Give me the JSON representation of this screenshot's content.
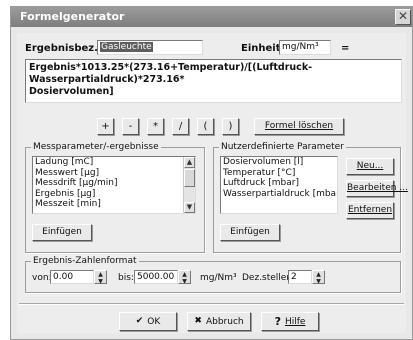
{
  "window": {
    "title": "Formelgenerator",
    "close_glyph": "✕"
  },
  "result": {
    "name_label": "Ergebnisbez.:",
    "name_value": "Gasleuchte",
    "unit_label": "Einheit:",
    "unit_value": "mg/Nm³",
    "equals": "="
  },
  "formula": {
    "line1": "Ergebnis*1013.25*(273.16+Temperatur)/[(Luftdruck-Wasserpartialdruck)*273.16*",
    "line2": "Dosiervolumen]"
  },
  "operators": [
    "+",
    "-",
    "*",
    "/",
    "(",
    ")"
  ],
  "clear_formula_label": "Formel löschen",
  "measure_group": {
    "legend": "Messparameter/-ergebnisse",
    "items": [
      "Ladung [mC]",
      "Messwert [µg]",
      "Messdrift [µg/min]",
      "Ergebnis [µg]",
      "Messzeit [min]"
    ],
    "insert_label": "Einfügen",
    "insert_accel": "i"
  },
  "user_group": {
    "legend": "Nutzerdefinierte Parameter",
    "items": [
      "Dosiervolumen [l]",
      "Temperatur [°C]",
      "Luftdruck [mbar]",
      "Wasserpartialdruck [mbar]"
    ],
    "insert_label": "Einfügen",
    "new_label": "Neu...",
    "edit_label": "Bearbeiten ...",
    "remove_label": "Entfernen"
  },
  "format_group": {
    "legend": "Ergebnis-Zahlenformat",
    "from_label": "von:",
    "from_value": "0.00",
    "to_label": "bis:",
    "to_value": "5000.00",
    "unit": "mg/Nm³",
    "decimals_label": "Dez.stellen:",
    "decimals_value": "2"
  },
  "footer": {
    "ok_label": "OK",
    "cancel_label": "Abbruch",
    "help_label": "Hilfe"
  },
  "icons": {
    "ok": "check-icon",
    "cancel": "cross-icon",
    "help": "question-icon"
  }
}
